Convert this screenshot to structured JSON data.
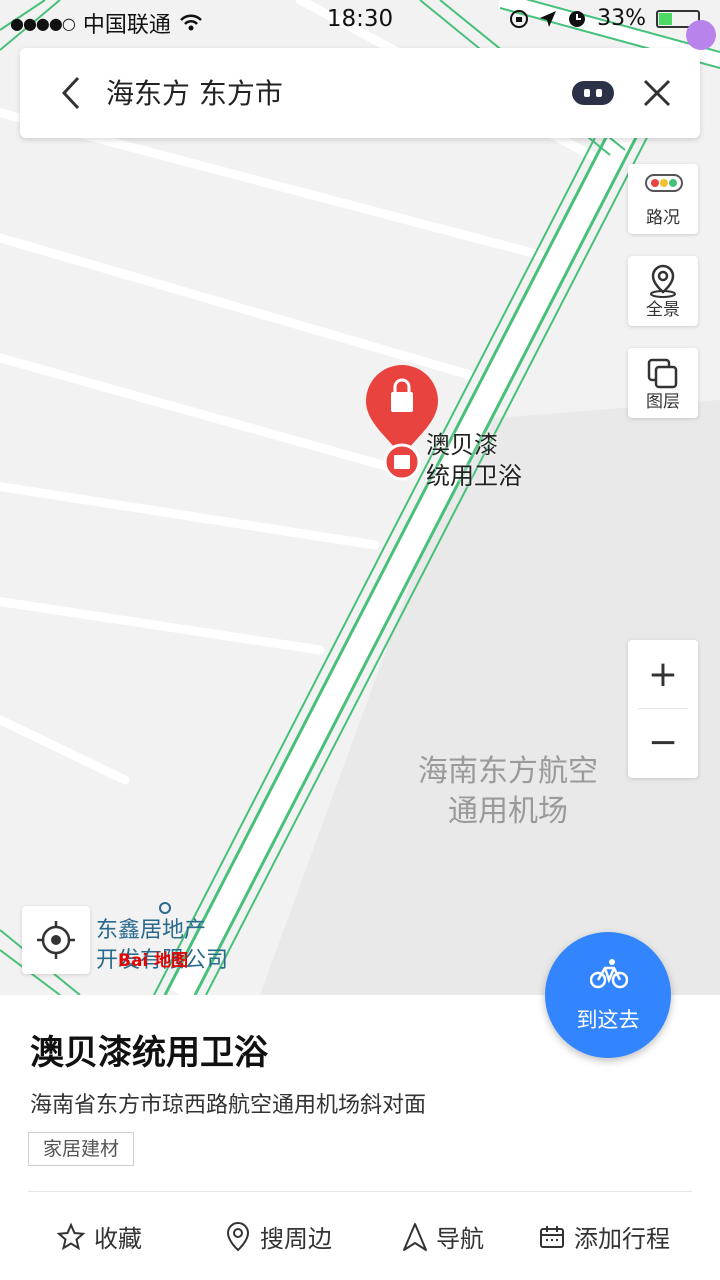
{
  "status_bar": {
    "signal": "●●●●○",
    "carrier": "中国联通",
    "time": "18:30",
    "battery": "33%"
  },
  "search": {
    "query": "海东方 东方市"
  },
  "map_controls": {
    "traffic_label": "路况",
    "panorama_label": "全景",
    "layers_label": "图层",
    "zoom_in": "+",
    "zoom_out": "−"
  },
  "map_labels": {
    "poi_line1": "澳贝漆",
    "poi_line2": "统用卫浴",
    "airport_line1": "海南东方航空",
    "airport_line2": "通用机场",
    "realestate_line1": "东鑫居地产",
    "realestate_line2": "开发有限公司",
    "baidu_logo_text": "Bai  地图"
  },
  "goto_button": {
    "label": "到这去",
    "icon": "bicycle-icon"
  },
  "poi_panel": {
    "title": "澳贝漆统用卫浴",
    "address": "海南省东方市琼西路航空通用机场斜对面",
    "tag": "家居建材",
    "actions": [
      {
        "label": "收藏",
        "icon": "star-icon"
      },
      {
        "label": "搜周边",
        "icon": "location-pin-icon"
      },
      {
        "label": "导航",
        "icon": "navigation-arrow-icon"
      },
      {
        "label": "添加行程",
        "icon": "calendar-icon"
      }
    ]
  },
  "colors": {
    "accent": "#3385ff",
    "poi_marker": "#e8433f",
    "road_green": "#47c07a"
  }
}
